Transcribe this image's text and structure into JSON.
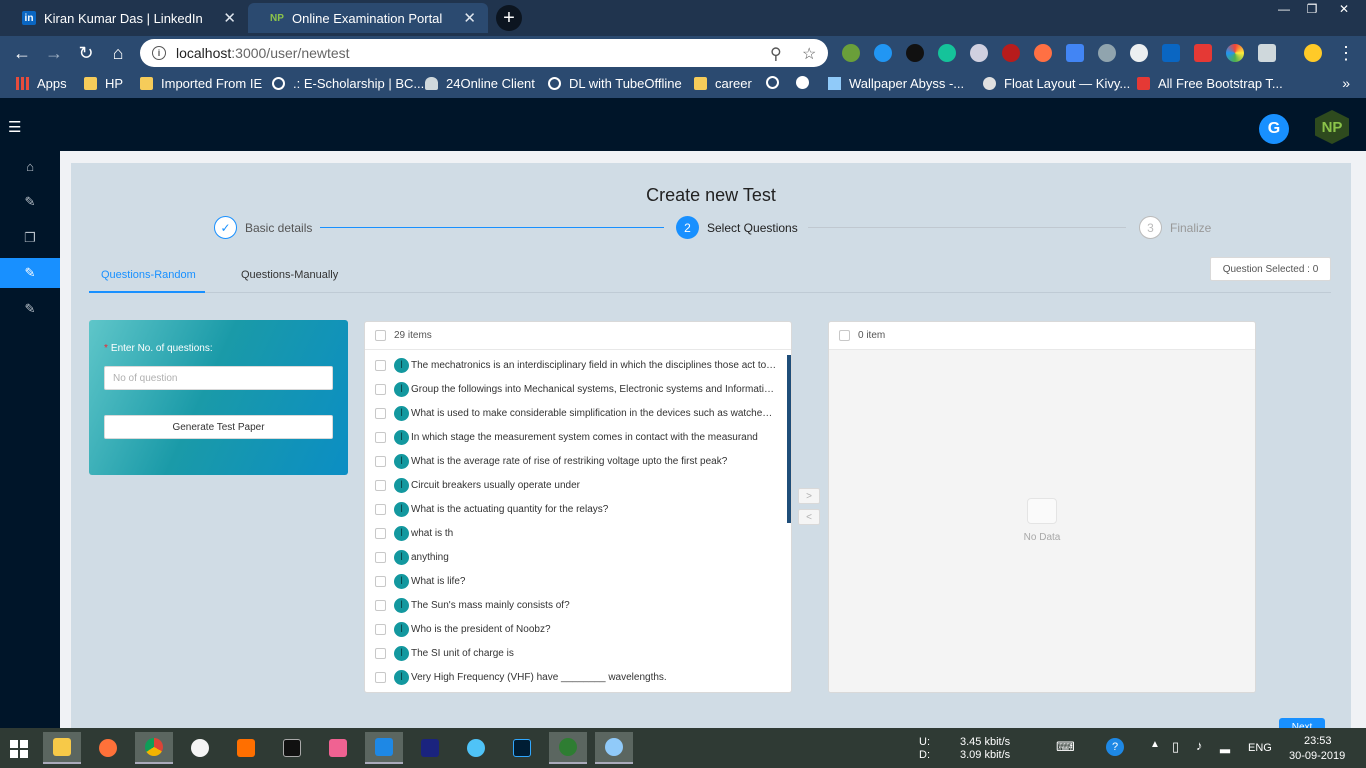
{
  "browser": {
    "tabs": [
      {
        "title": "Kiran Kumar Das | LinkedIn",
        "icon": "linkedin-icon"
      },
      {
        "title": "Online Examination Portal",
        "icon": "np-favicon"
      }
    ],
    "url_host": "localhost",
    "url_path": ":3000/user/newtest",
    "bookmarks": [
      {
        "label": "Apps",
        "icon": "apps"
      },
      {
        "label": "HP",
        "icon": "folder"
      },
      {
        "label": "Imported From IE",
        "icon": "folder"
      },
      {
        "label": ".: E-Scholarship | BC...",
        "icon": "globe"
      },
      {
        "label": "24Online Client",
        "icon": "cloud"
      },
      {
        "label": "DL with TubeOffline",
        "icon": "globe"
      },
      {
        "label": "career",
        "icon": "folder"
      },
      {
        "label": "",
        "icon": "globe"
      },
      {
        "label": "",
        "icon": "github"
      },
      {
        "label": "Wallpaper Abyss -...",
        "icon": "tube"
      },
      {
        "label": "Float Layout — Kivy...",
        "icon": "kivy"
      },
      {
        "label": "All Free Bootstrap T...",
        "icon": "red"
      }
    ]
  },
  "page": {
    "title": "Create new Test",
    "steps": [
      {
        "num": "✓",
        "label": "Basic details",
        "state": "done"
      },
      {
        "num": "2",
        "label": "Select Questions",
        "state": "current"
      },
      {
        "num": "3",
        "label": "Finalize",
        "state": "wait"
      }
    ],
    "tabs": [
      "Questions-Random",
      "Questions-Manually"
    ],
    "question_selected": "Question Selected : 0",
    "generator": {
      "label": "Enter No. of questions:",
      "placeholder": "No of question",
      "button": "Generate Test Paper"
    },
    "source_list": {
      "header": "29 items",
      "items": [
        "The mechatronics is an interdisciplinary field in which the disciplines those act together are",
        " Group the followings into Mechanical systems, Electronic systems and Information technology",
        "What is used to make considerable simplification in the devices such as watches, cameras",
        " In which stage the measurement system comes in contact with the measurand",
        "What is the average rate of rise of restriking voltage upto the first peak?",
        "Circuit breakers usually operate under",
        "What is the actuating quantity for the relays?",
        "what is th",
        "anything",
        "What is life?",
        " The Sun's mass mainly consists of?",
        "Who is the president of Noobz?",
        "The SI unit of charge is",
        "Very High Frequency (VHF) have ________ wavelengths."
      ]
    },
    "target_list": {
      "header": "0 item",
      "empty_text": "No Data"
    },
    "next_button": "Next"
  },
  "taskbar": {
    "upload_label": "U:",
    "download_label": "D:",
    "upload_speed": "3.45 kbit/s",
    "download_speed": "3.09 kbit/s",
    "language": "ENG",
    "time": "23:53",
    "date": "30-09-2019"
  }
}
